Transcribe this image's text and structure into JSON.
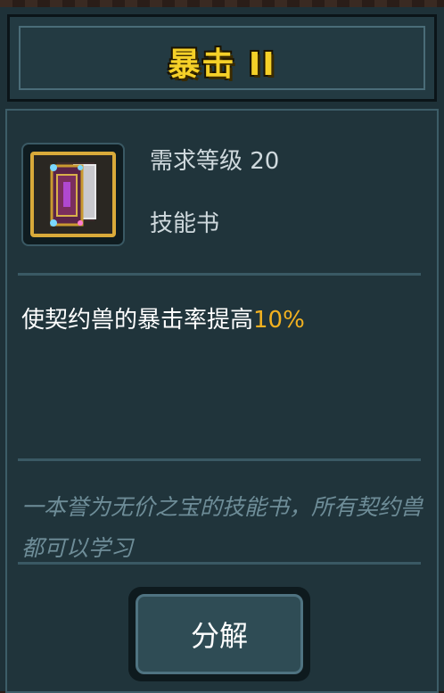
{
  "title": "暴击 II",
  "item": {
    "icon": "skill-book-icon",
    "level_requirement": "需求等级 20",
    "type": "技能书"
  },
  "description": {
    "text": "使契约兽的暴击率提高",
    "highlight": "10%"
  },
  "flavor": "一本誉为无价之宝的技能书，所有契约兽都可以学习",
  "actions": {
    "decompose_label": "分解"
  },
  "colors": {
    "title": "#f5d028",
    "highlight": "#f2b120",
    "frame_gold": "#d9aa3a",
    "panel": "#1e3138"
  }
}
